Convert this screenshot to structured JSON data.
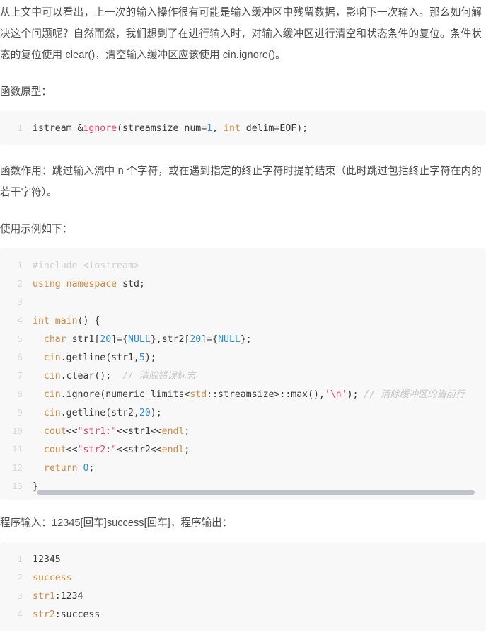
{
  "document": {
    "paragraphs": {
      "intro": "从上文中可以看出，上一次的输入操作很有可能是输入缓冲区中残留数据，影响下一次输入。那么如何解决这个问题呢？自然而然，我们想到了在进行输入时，对输入缓冲区进行清空和状态条件的复位。条件状态的复位使用 clear()，清空输入缓冲区应该使用 cin.ignore()。",
      "prototype_label": "函数原型：",
      "function_purpose": "函数作用：跳过输入流中 n 个字符，或在遇到指定的终止字符时提前结束（此时跳过包括终止字符在内的若干字符）。",
      "example_label": "使用示例如下：",
      "program_io": "程序输入：12345[回车]success[回车]，程序输出："
    },
    "prototype_code": {
      "lines": [
        {
          "number": "1",
          "tokens": [
            {
              "text": "istream &",
              "cls": "t-plain"
            },
            {
              "text": "ignore",
              "cls": "t-fn"
            },
            {
              "text": "(streamsize num=",
              "cls": "t-plain"
            },
            {
              "text": "1",
              "cls": "t-num"
            },
            {
              "text": ", ",
              "cls": "t-plain"
            },
            {
              "text": "int",
              "cls": "t-kw"
            },
            {
              "text": " delim=EOF);",
              "cls": "t-plain"
            }
          ]
        }
      ]
    },
    "example_code": {
      "scrollbar": true,
      "lines": [
        {
          "number": "1",
          "tokens": [
            {
              "text": "#include <iostream>",
              "cls": "t-pre"
            }
          ]
        },
        {
          "number": "2",
          "tokens": [
            {
              "text": "using",
              "cls": "t-kw"
            },
            {
              "text": " ",
              "cls": "t-plain"
            },
            {
              "text": "namespace",
              "cls": "t-kw"
            },
            {
              "text": " std;",
              "cls": "t-plain"
            }
          ]
        },
        {
          "number": "3",
          "tokens": [
            {
              "text": "",
              "cls": "t-plain"
            }
          ]
        },
        {
          "number": "4",
          "tokens": [
            {
              "text": "int",
              "cls": "t-kw"
            },
            {
              "text": " ",
              "cls": "t-plain"
            },
            {
              "text": "main",
              "cls": "t-kw"
            },
            {
              "text": "() {",
              "cls": "t-plain"
            }
          ]
        },
        {
          "number": "5",
          "tokens": [
            {
              "text": "  ",
              "cls": "t-plain"
            },
            {
              "text": "char",
              "cls": "t-kw"
            },
            {
              "text": " str1[",
              "cls": "t-plain"
            },
            {
              "text": "20",
              "cls": "t-num"
            },
            {
              "text": "]={",
              "cls": "t-plain"
            },
            {
              "text": "NULL",
              "cls": "t-num"
            },
            {
              "text": "},str2[",
              "cls": "t-plain"
            },
            {
              "text": "20",
              "cls": "t-num"
            },
            {
              "text": "]={",
              "cls": "t-plain"
            },
            {
              "text": "NULL",
              "cls": "t-num"
            },
            {
              "text": "};",
              "cls": "t-plain"
            }
          ]
        },
        {
          "number": "6",
          "tokens": [
            {
              "text": "  ",
              "cls": "t-plain"
            },
            {
              "text": "cin",
              "cls": "t-kw"
            },
            {
              "text": ".getline(str1,",
              "cls": "t-plain"
            },
            {
              "text": "5",
              "cls": "t-num"
            },
            {
              "text": ");",
              "cls": "t-plain"
            }
          ]
        },
        {
          "number": "7",
          "tokens": [
            {
              "text": "  ",
              "cls": "t-plain"
            },
            {
              "text": "cin",
              "cls": "t-kw"
            },
            {
              "text": ".clear();  ",
              "cls": "t-plain"
            },
            {
              "text": "// 清除错误标志",
              "cls": "t-cmt"
            }
          ]
        },
        {
          "number": "8",
          "tokens": [
            {
              "text": "  ",
              "cls": "t-plain"
            },
            {
              "text": "cin",
              "cls": "t-kw"
            },
            {
              "text": ".ignore(numeric_limits<",
              "cls": "t-plain"
            },
            {
              "text": "std",
              "cls": "t-kw"
            },
            {
              "text": "::streamsize>::max(),",
              "cls": "t-plain"
            },
            {
              "text": "'\\n'",
              "cls": "t-str"
            },
            {
              "text": "); ",
              "cls": "t-plain"
            },
            {
              "text": "// 清除缓冲区的当前行",
              "cls": "t-cmt"
            }
          ]
        },
        {
          "number": "9",
          "tokens": [
            {
              "text": "  ",
              "cls": "t-plain"
            },
            {
              "text": "cin",
              "cls": "t-kw"
            },
            {
              "text": ".getline(str2,",
              "cls": "t-plain"
            },
            {
              "text": "20",
              "cls": "t-num"
            },
            {
              "text": ");",
              "cls": "t-plain"
            }
          ]
        },
        {
          "number": "10",
          "tokens": [
            {
              "text": "  ",
              "cls": "t-plain"
            },
            {
              "text": "cout",
              "cls": "t-kw"
            },
            {
              "text": "<<",
              "cls": "t-plain"
            },
            {
              "text": "\"str1:\"",
              "cls": "t-str"
            },
            {
              "text": "<<str1<<",
              "cls": "t-plain"
            },
            {
              "text": "endl",
              "cls": "t-kw"
            },
            {
              "text": ";",
              "cls": "t-plain"
            }
          ]
        },
        {
          "number": "11",
          "tokens": [
            {
              "text": "  ",
              "cls": "t-plain"
            },
            {
              "text": "cout",
              "cls": "t-kw"
            },
            {
              "text": "<<",
              "cls": "t-plain"
            },
            {
              "text": "\"str2:\"",
              "cls": "t-str"
            },
            {
              "text": "<<str2<<",
              "cls": "t-plain"
            },
            {
              "text": "endl",
              "cls": "t-kw"
            },
            {
              "text": ";",
              "cls": "t-plain"
            }
          ]
        },
        {
          "number": "12",
          "tokens": [
            {
              "text": "  ",
              "cls": "t-plain"
            },
            {
              "text": "return",
              "cls": "t-kw"
            },
            {
              "text": " ",
              "cls": "t-plain"
            },
            {
              "text": "0",
              "cls": "t-num"
            },
            {
              "text": ";",
              "cls": "t-plain"
            }
          ]
        },
        {
          "number": "13",
          "tokens": [
            {
              "text": "}",
              "cls": "t-plain"
            }
          ]
        }
      ]
    },
    "output_code": {
      "scrollbar": false,
      "lines": [
        {
          "number": "1",
          "tokens": [
            {
              "text": "12345",
              "cls": "t-plain"
            }
          ]
        },
        {
          "number": "2",
          "tokens": [
            {
              "text": "success",
              "cls": "t-kw"
            }
          ]
        },
        {
          "number": "3",
          "tokens": [
            {
              "text": "str1",
              "cls": "t-kw"
            },
            {
              "text": ":1234",
              "cls": "t-plain"
            }
          ]
        },
        {
          "number": "4",
          "tokens": [
            {
              "text": "str2",
              "cls": "t-kw"
            },
            {
              "text": ":success",
              "cls": "t-plain"
            }
          ]
        }
      ]
    }
  },
  "colors": {
    "code_background": "#f8f8f8",
    "keyword": "#d08b42",
    "function": "#e2456a",
    "number": "#2a8fd4",
    "string": "#e2456a",
    "comment": "#c4c4c4",
    "text": "#4d4d4d",
    "line_number": "#d8d8d8",
    "scrollbar": "#c0c3c9"
  }
}
